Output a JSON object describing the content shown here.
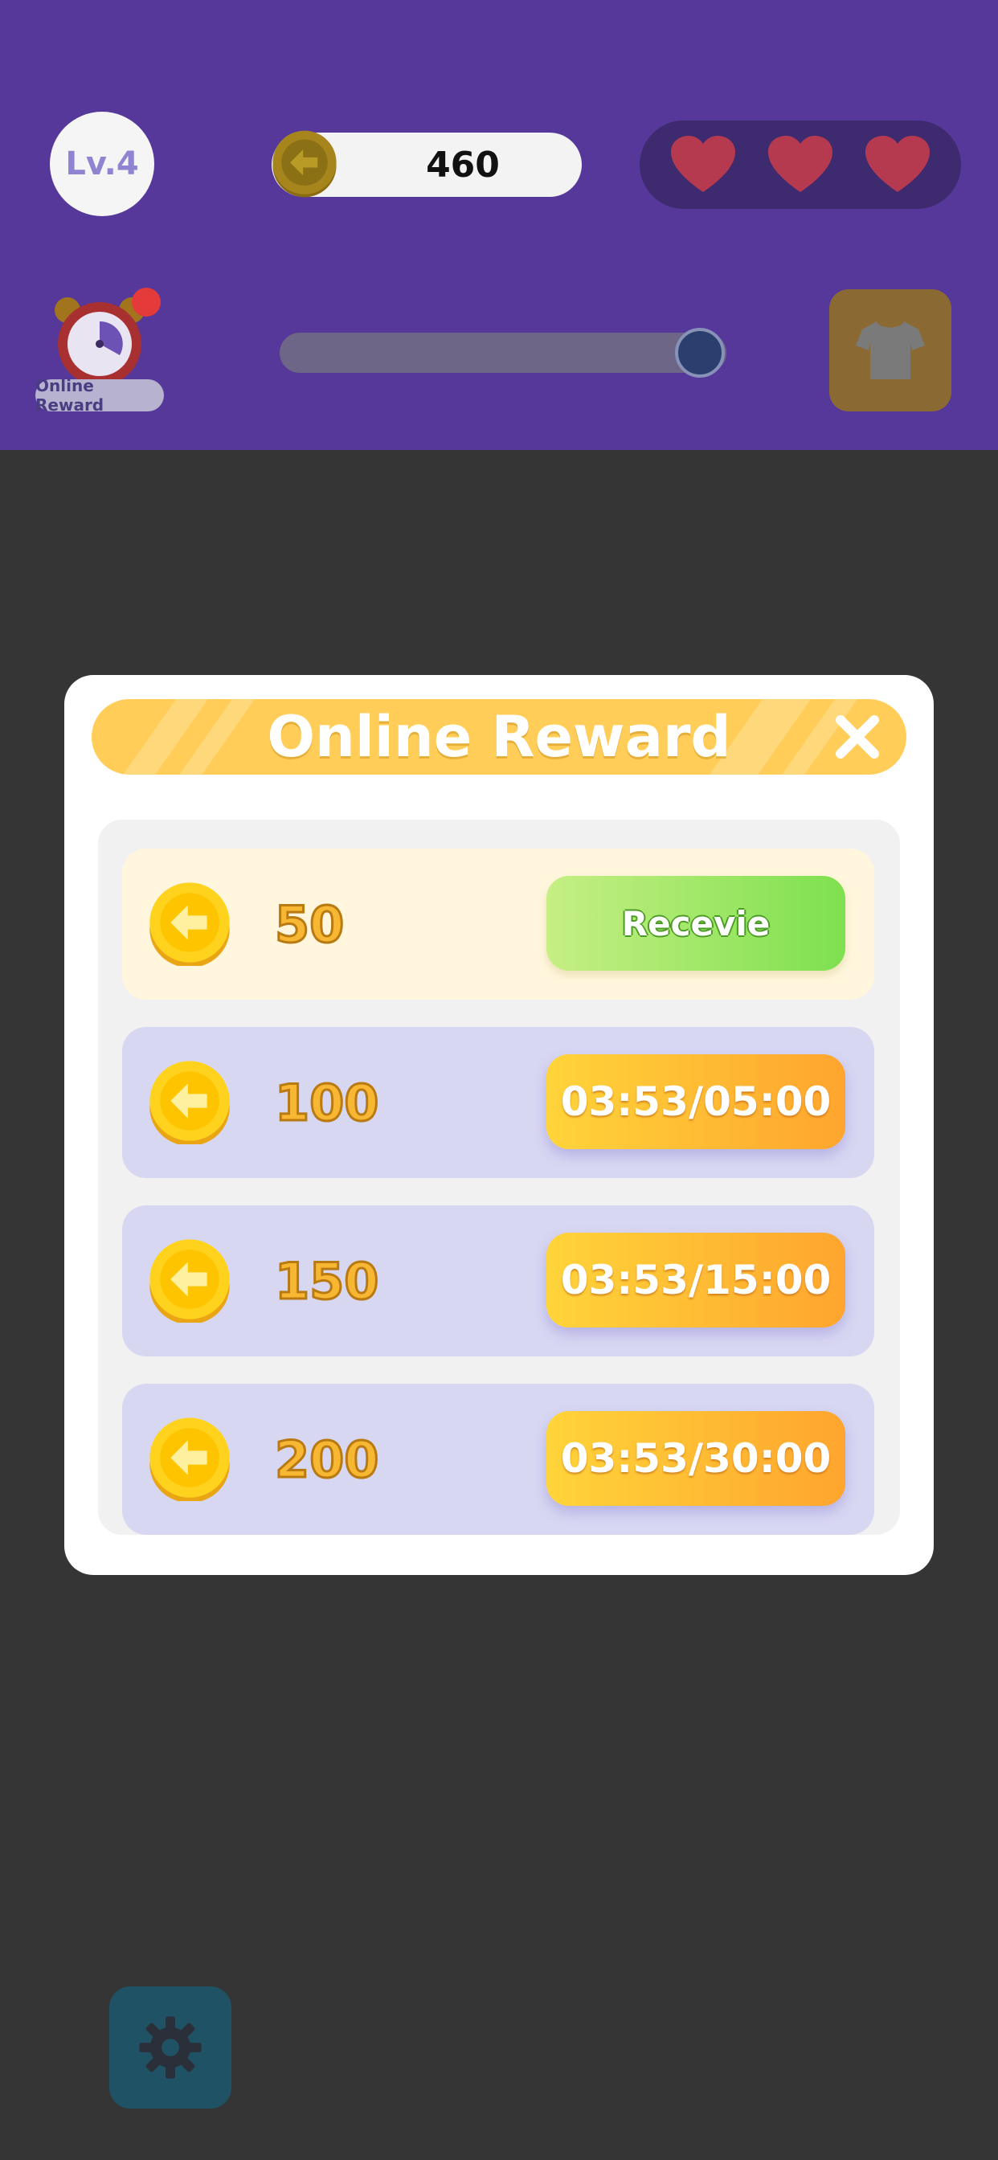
{
  "header": {
    "level_label": "Lv.4",
    "coin_count": "460",
    "hearts": [
      "heart-icon",
      "heart-icon",
      "heart-icon"
    ],
    "online_reward_label": "Online Reward",
    "progress_fraction": 0.94
  },
  "modal": {
    "title": "Online Reward",
    "rows": [
      {
        "amount": "50",
        "button": "Recevie",
        "state": "ready"
      },
      {
        "amount": "100",
        "button": "03:53/05:00",
        "state": "timer"
      },
      {
        "amount": "150",
        "button": "03:53/15:00",
        "state": "timer"
      },
      {
        "amount": "200",
        "button": "03:53/30:00",
        "state": "timer"
      }
    ]
  },
  "colors": {
    "header_bg": "#55389a",
    "title_bar": "#ffcd58",
    "receive_green": "#7ee04f",
    "timer_orange": "#ffa52e",
    "row_lavender": "#d8d7f2",
    "row_cream": "#fff6dd"
  },
  "icons": {
    "coin": "coin-arrow-icon",
    "clock": "alarm-clock-icon",
    "shirt": "shirt-icon",
    "settings": "gear-icon",
    "close": "close-icon"
  }
}
